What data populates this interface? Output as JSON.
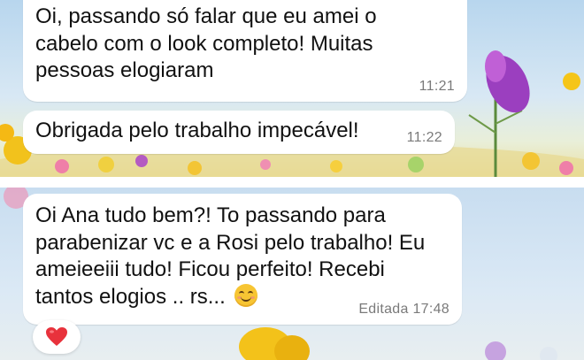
{
  "chat": {
    "messages": [
      {
        "text": "Oi, passando só falar que eu amei o\ncabelo com o look completo! Muitas\npessoas elogiaram",
        "time": "11:21"
      },
      {
        "text": "Obrigada pelo trabalho impecável!",
        "time": "11:22"
      },
      {
        "text": "Oi Ana tudo bem?! To passando para\nparabenizar vc e a Rosi pelo trabalho! Eu\nameieeiii tudo! Ficou perfeito! Recebi\ntantos elogios .. rs...",
        "emoji": "smiling-face-emoji",
        "edited_label": "Editada",
        "time": "17:48",
        "reaction": "red-heart"
      }
    ]
  },
  "colors": {
    "bubble": "#ffffff",
    "timestamp": "#7a7a7a",
    "heart": "#e8323c"
  }
}
